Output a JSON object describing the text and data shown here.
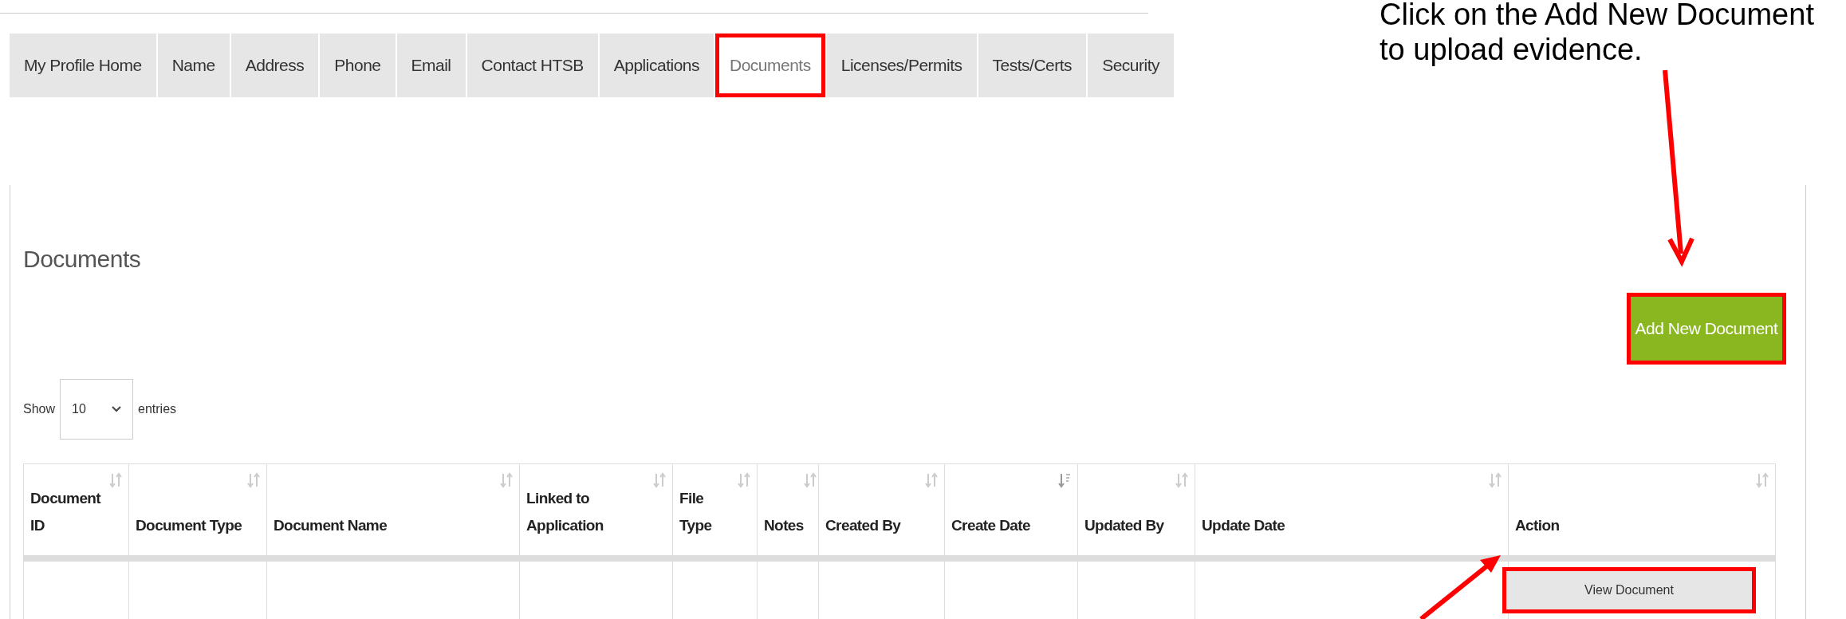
{
  "tabs": [
    {
      "label": "My Profile Home",
      "selected": false,
      "highlighted": false
    },
    {
      "label": "Name",
      "selected": false,
      "highlighted": false
    },
    {
      "label": "Address",
      "selected": false,
      "highlighted": false
    },
    {
      "label": "Phone",
      "selected": false,
      "highlighted": false
    },
    {
      "label": "Email",
      "selected": false,
      "highlighted": false
    },
    {
      "label": "Contact HTSB",
      "selected": false,
      "highlighted": false
    },
    {
      "label": "Applications",
      "selected": false,
      "highlighted": false
    },
    {
      "label": "Documents",
      "selected": true,
      "highlighted": true
    },
    {
      "label": "Licenses/Permits",
      "selected": false,
      "highlighted": false
    },
    {
      "label": "Tests/Certs",
      "selected": false,
      "highlighted": false
    },
    {
      "label": "Security",
      "selected": false,
      "highlighted": false
    }
  ],
  "callout": {
    "lines": [
      "Click on the Add New Document",
      "to upload evidence."
    ]
  },
  "heading": "Documents",
  "add_button": {
    "label": "Add New Document",
    "highlighted": true
  },
  "length_menu": {
    "prefix": "Show",
    "value": "10",
    "suffix": "entries"
  },
  "table": {
    "columns": [
      {
        "label": "Document ID",
        "sorted": false
      },
      {
        "label": "Document Type",
        "sorted": false
      },
      {
        "label": "Document Name",
        "sorted": false
      },
      {
        "label": "Linked to Application",
        "sorted": false
      },
      {
        "label": "File Type",
        "sorted": false
      },
      {
        "label": "Notes",
        "sorted": false
      },
      {
        "label": "Created By",
        "sorted": false
      },
      {
        "label": "Create Date",
        "sorted": true
      },
      {
        "label": "Updated By",
        "sorted": false
      },
      {
        "label": "Update Date",
        "sorted": false
      },
      {
        "label": "Action",
        "sorted": false
      }
    ],
    "action_button": {
      "label": "View Document",
      "highlighted": true
    }
  }
}
